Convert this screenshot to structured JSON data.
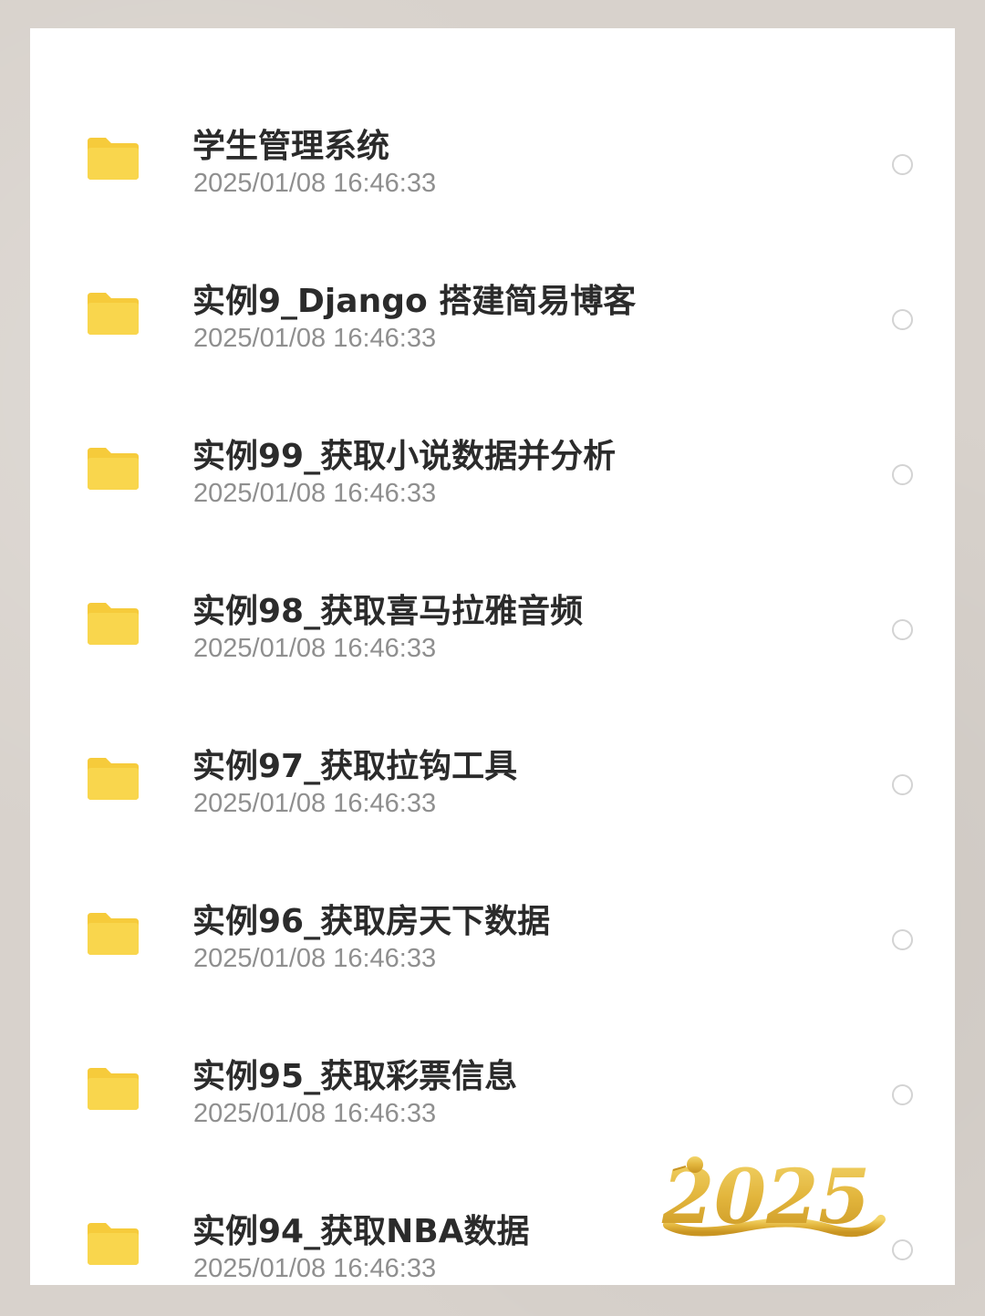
{
  "files": [
    {
      "name": "学生管理系统",
      "date": "2025/01/08 16:46:33"
    },
    {
      "name": "实例9_Django 搭建简易博客",
      "date": "2025/01/08 16:46:33"
    },
    {
      "name": "实例99_获取小说数据并分析",
      "date": "2025/01/08 16:46:33"
    },
    {
      "name": "实例98_获取喜马拉雅音频",
      "date": "2025/01/08 16:46:33"
    },
    {
      "name": "实例97_获取拉钩工具",
      "date": "2025/01/08 16:46:33"
    },
    {
      "name": "实例96_获取房天下数据",
      "date": "2025/01/08 16:46:33"
    },
    {
      "name": "实例95_获取彩票信息",
      "date": "2025/01/08 16:46:33"
    },
    {
      "name": "实例94_获取NBA数据",
      "date": "2025/01/08 16:46:33"
    }
  ],
  "decoration": {
    "text": "2025",
    "icon": "snake-2025-badge"
  },
  "colors": {
    "folder": "#f9d64d",
    "folder_tab": "#f6cb3b",
    "title": "#2b2b2b",
    "date": "#8f8f8f",
    "radio": "#d3d3d3"
  }
}
